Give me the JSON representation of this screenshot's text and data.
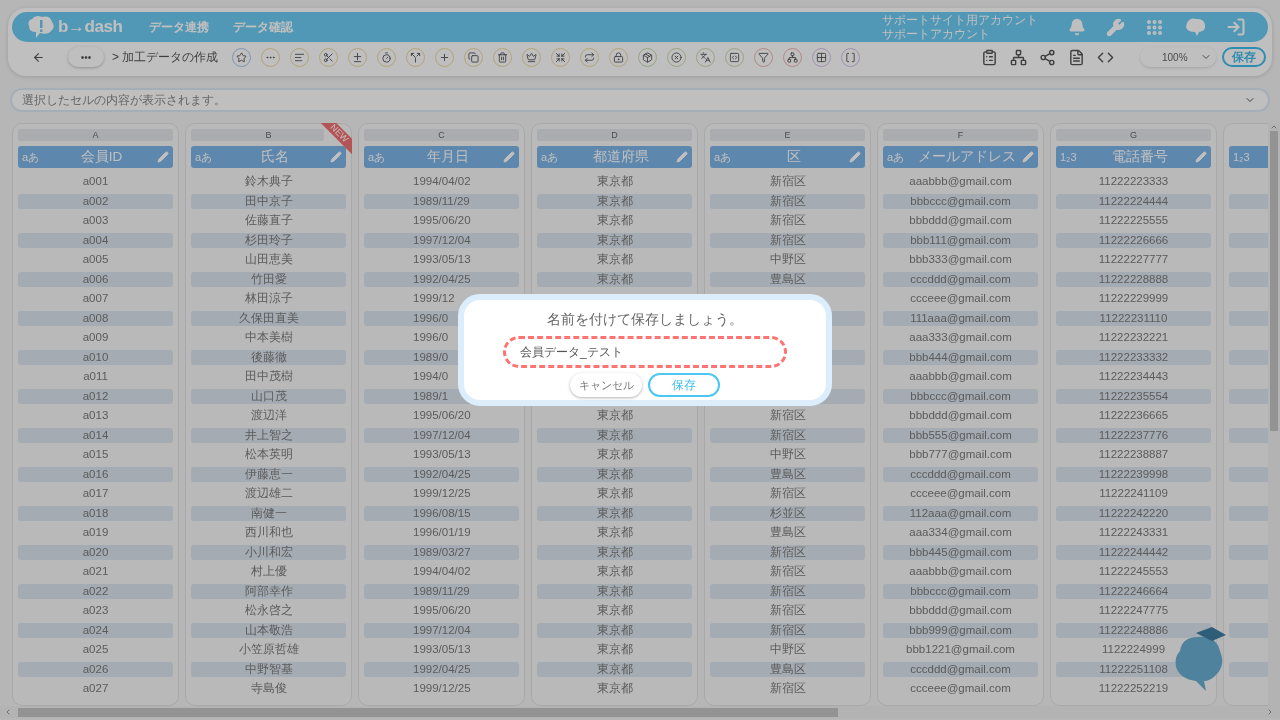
{
  "header": {
    "logo": "b→dash",
    "nav": [
      {
        "label": "データ連携"
      },
      {
        "label": "データ確認"
      }
    ],
    "account": [
      "サポートサイト用アカウント",
      "サポートアカウント"
    ]
  },
  "toolbar": {
    "more": "•••",
    "breadcrumb": "> 加工データの作成",
    "zoom": "100%",
    "save": "保存"
  },
  "formula_bar": {
    "placeholder": "選択したセルの内容が表示されます。"
  },
  "columns": [
    {
      "letter": "A",
      "type_label": "aあ",
      "name": "会員ID"
    },
    {
      "letter": "B",
      "type_label": "aあ",
      "name": "氏名",
      "badge": "NEW"
    },
    {
      "letter": "C",
      "type_label": "aあ",
      "name": "年月日"
    },
    {
      "letter": "D",
      "type_label": "aあ",
      "name": "都道府県"
    },
    {
      "letter": "E",
      "type_label": "aあ",
      "name": "区"
    },
    {
      "letter": "F",
      "type_label": "aあ",
      "name": "メールアドレス"
    },
    {
      "letter": "G",
      "type_label": "1₂3",
      "name": "電話番号"
    },
    {
      "type_label": "1₂3"
    }
  ],
  "rows": [
    {
      "A": "a001",
      "B": "鈴木典子",
      "C": "1994/04/02",
      "D": "東京都",
      "E": "新宿区",
      "F": "aaabbb@gmail.com",
      "G": "11222223333"
    },
    {
      "A": "a002",
      "B": "田中京子",
      "C": "1989/11/29",
      "D": "東京都",
      "E": "新宿区",
      "F": "bbbccc@gmail.com",
      "G": "11222224444"
    },
    {
      "A": "a003",
      "B": "佐藤直子",
      "C": "1995/06/20",
      "D": "東京都",
      "E": "新宿区",
      "F": "bbbddd@gmail.com",
      "G": "11222225555"
    },
    {
      "A": "a004",
      "B": "杉田玲子",
      "C": "1997/12/04",
      "D": "東京都",
      "E": "新宿区",
      "F": "bbb111@gmail.com",
      "G": "11222226666"
    },
    {
      "A": "a005",
      "B": "山田恵美",
      "C": "1993/05/13",
      "D": "東京都",
      "E": "中野区",
      "F": "bbb333@gmail.com",
      "G": "11222227777"
    },
    {
      "A": "a006",
      "B": "竹田愛",
      "C": "1992/04/25",
      "D": "東京都",
      "E": "豊島区",
      "F": "cccddd@gmail.com",
      "G": "11222228888"
    },
    {
      "A": "a007",
      "B": "林田涼子",
      "C": "1999/12",
      "F": "ccceee@gmail.com",
      "G": "11222229999"
    },
    {
      "A": "a008",
      "B": "久保田直美",
      "C": "1996/0",
      "F": "111aaa@gmail.com",
      "G": "11222231110"
    },
    {
      "A": "a009",
      "B": "中本美樹",
      "C": "1996/0",
      "F": "aaa333@gmail.com",
      "G": "11222232221"
    },
    {
      "A": "a010",
      "B": "後藤徹",
      "C": "1989/0",
      "F": "bbb444@gmail.com",
      "G": "11222233332"
    },
    {
      "A": "a011",
      "B": "田中茂樹",
      "C": "1994/0",
      "F": "aaabbb@gmail.com",
      "G": "11222234443"
    },
    {
      "A": "a012",
      "B": "山口茂",
      "C": "1989/1",
      "F": "bbbccc@gmail.com",
      "G": "11222235554"
    },
    {
      "A": "a013",
      "B": "渡辺洋",
      "C": "1995/06/20",
      "D": "東京都",
      "E": "新宿区",
      "F": "bbbddd@gmail.com",
      "G": "11222236665"
    },
    {
      "A": "a014",
      "B": "井上智之",
      "C": "1997/12/04",
      "D": "東京都",
      "E": "新宿区",
      "F": "bbb555@gmail.com",
      "G": "11222237776"
    },
    {
      "A": "a015",
      "B": "松本英明",
      "C": "1993/05/13",
      "D": "東京都",
      "E": "中野区",
      "F": "bbb777@gmail.com",
      "G": "11222238887"
    },
    {
      "A": "a016",
      "B": "伊藤恵一",
      "C": "1992/04/25",
      "D": "東京都",
      "E": "豊島区",
      "F": "cccddd@gmail.com",
      "G": "11222239998"
    },
    {
      "A": "a017",
      "B": "渡辺雄二",
      "C": "1999/12/25",
      "D": "東京都",
      "E": "新宿区",
      "F": "ccceee@gmail.com",
      "G": "11222241109"
    },
    {
      "A": "a018",
      "B": "南健一",
      "C": "1996/08/15",
      "D": "東京都",
      "E": "杉並区",
      "F": "112aaa@gmail.com",
      "G": "11222242220"
    },
    {
      "A": "a019",
      "B": "西川和也",
      "C": "1996/01/19",
      "D": "東京都",
      "E": "豊島区",
      "F": "aaa334@gmail.com",
      "G": "11222243331"
    },
    {
      "A": "a020",
      "B": "小川和宏",
      "C": "1989/03/27",
      "D": "東京都",
      "E": "新宿区",
      "F": "bbb445@gmail.com",
      "G": "11222244442"
    },
    {
      "A": "a021",
      "B": "村上優",
      "C": "1994/04/02",
      "D": "東京都",
      "E": "新宿区",
      "F": "aaabbb@gmail.com",
      "G": "11222245553"
    },
    {
      "A": "a022",
      "B": "阿部幸作",
      "C": "1989/11/29",
      "D": "東京都",
      "E": "新宿区",
      "F": "bbbccc@gmail.com",
      "G": "11222246664"
    },
    {
      "A": "a023",
      "B": "松永啓之",
      "C": "1995/06/20",
      "D": "東京都",
      "E": "新宿区",
      "F": "bbbddd@gmail.com",
      "G": "11222247775"
    },
    {
      "A": "a024",
      "B": "山本敬浩",
      "C": "1997/12/04",
      "D": "東京都",
      "E": "新宿区",
      "F": "bbb999@gmail.com",
      "G": "11222248886"
    },
    {
      "A": "a025",
      "B": "小笠原哲雄",
      "C": "1993/05/13",
      "D": "東京都",
      "E": "中野区",
      "F": "bbb1221@gmail.com",
      "G": "1122224999"
    },
    {
      "A": "a026",
      "B": "中野智基",
      "C": "1992/04/25",
      "D": "東京都",
      "E": "豊島区",
      "F": "cccddd@gmail.com",
      "G": "11222251108"
    },
    {
      "A": "a027",
      "B": "寺島俊",
      "C": "1999/12/25",
      "D": "東京都",
      "E": "新宿区",
      "F": "ccceee@gmail.com",
      "G": "11222252219"
    }
  ],
  "dialog": {
    "title": "名前を付けて保存しましょう。",
    "value": "会員データ_テスト",
    "cancel": "キャンセル",
    "save": "保存"
  }
}
